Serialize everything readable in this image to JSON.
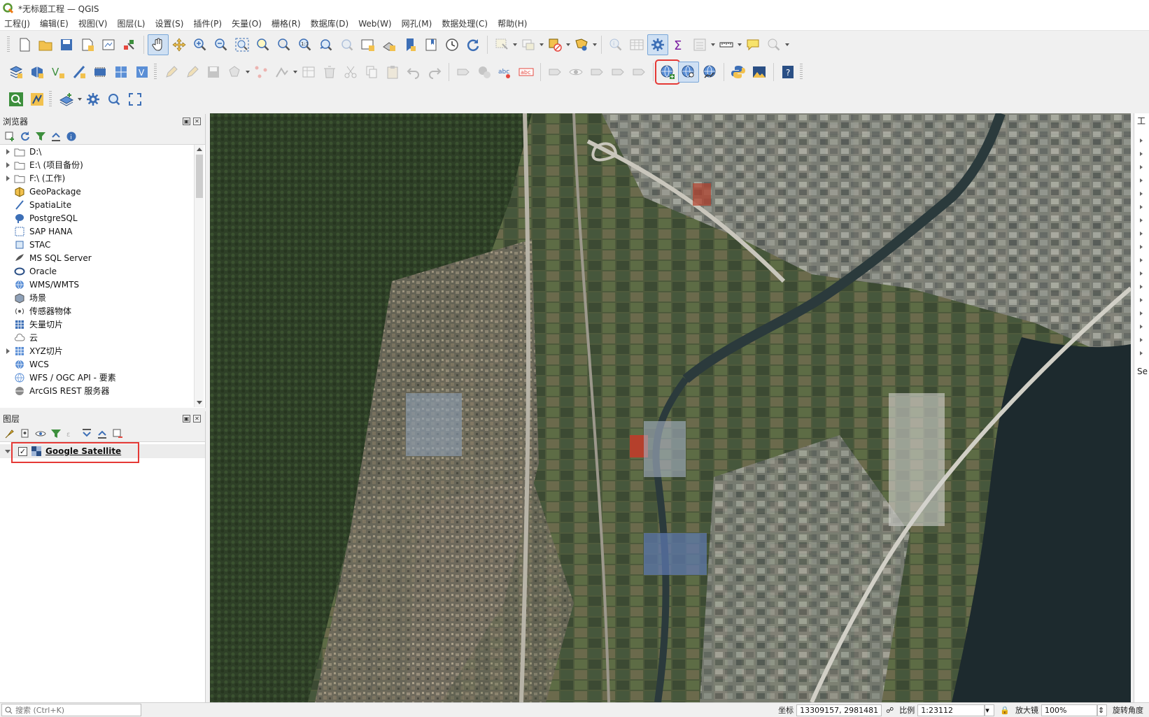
{
  "window": {
    "title": "*无标题工程 — QGIS"
  },
  "menu": [
    {
      "label": "工程(J)"
    },
    {
      "label": "编辑(E)"
    },
    {
      "label": "视图(V)"
    },
    {
      "label": "图层(L)"
    },
    {
      "label": "设置(S)"
    },
    {
      "label": "插件(P)"
    },
    {
      "label": "矢量(O)"
    },
    {
      "label": "栅格(R)"
    },
    {
      "label": "数据库(D)"
    },
    {
      "label": "Web(W)"
    },
    {
      "label": "网孔(M)"
    },
    {
      "label": "数据处理(C)"
    },
    {
      "label": "帮助(H)"
    }
  ],
  "browser": {
    "title": "浏览器",
    "items": [
      {
        "label": "D:\\",
        "icon": "folder-icon",
        "expandable": true
      },
      {
        "label": "E:\\ (项目备份)",
        "icon": "folder-icon",
        "expandable": true
      },
      {
        "label": "F:\\ (工作)",
        "icon": "folder-icon",
        "expandable": true
      },
      {
        "label": "GeoPackage",
        "icon": "geopackage-icon",
        "expandable": false
      },
      {
        "label": "SpatiaLite",
        "icon": "spatialite-icon",
        "expandable": false
      },
      {
        "label": "PostgreSQL",
        "icon": "postgresql-icon",
        "expandable": false
      },
      {
        "label": "SAP HANA",
        "icon": "sap-hana-icon",
        "expandable": false
      },
      {
        "label": "STAC",
        "icon": "stac-icon",
        "expandable": false
      },
      {
        "label": "MS SQL Server",
        "icon": "mssql-icon",
        "expandable": false
      },
      {
        "label": "Oracle",
        "icon": "oracle-icon",
        "expandable": false
      },
      {
        "label": "WMS/WMTS",
        "icon": "wms-icon",
        "expandable": false
      },
      {
        "label": "场景",
        "icon": "scene-icon",
        "expandable": false
      },
      {
        "label": "传感器物体",
        "icon": "sensor-icon",
        "expandable": false
      },
      {
        "label": "矢量切片",
        "icon": "vector-tile-icon",
        "expandable": false
      },
      {
        "label": "云",
        "icon": "cloud-icon",
        "expandable": false
      },
      {
        "label": "XYZ切片",
        "icon": "xyz-tile-icon",
        "expandable": true
      },
      {
        "label": "WCS",
        "icon": "wcs-icon",
        "expandable": false
      },
      {
        "label": "WFS / OGC API - 要素",
        "icon": "wfs-icon",
        "expandable": false
      },
      {
        "label": "ArcGIS REST 服务器",
        "icon": "arcgis-rest-icon",
        "expandable": false
      }
    ]
  },
  "layers": {
    "title": "图层",
    "items": [
      {
        "label": "Google Satellite",
        "checked": true
      }
    ]
  },
  "rightdock": {
    "title": "工",
    "search_label": "Se"
  },
  "statusbar": {
    "search_placeholder": "搜索 (Ctrl+K)",
    "coord_label": "坐标",
    "coord_value": "13309157, 2981481",
    "scale_label": "比例",
    "scale_value": "1:23112",
    "magnifier_label": "放大镜",
    "magnifier_value": "100%",
    "rotation_label": "旋转角度"
  },
  "colors": {
    "highlight_red": "#e53935",
    "water": "#1d2a2e",
    "vegetation": "#34452c"
  }
}
